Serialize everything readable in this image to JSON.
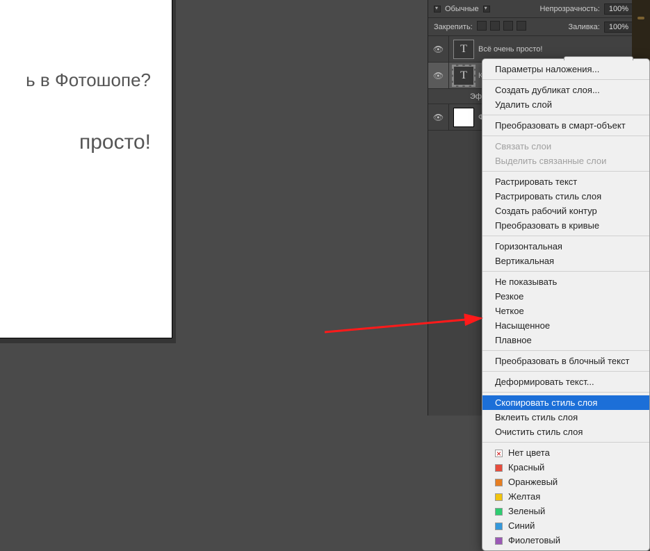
{
  "canvas_text": {
    "line1": "ь в Фотошопе?",
    "line2": "просто!"
  },
  "panel": {
    "blend_label": "Обычные",
    "opacity_label": "Непрозрачность:",
    "opacity_value": "100%",
    "lock_label": "Закрепить:",
    "fill_label": "Заливка:",
    "fill_value": "100%"
  },
  "layers": [
    {
      "name": "Всё очень просто!"
    },
    {
      "name": "Ка"
    },
    {
      "name": "Эфф"
    },
    {
      "name": "Фон"
    }
  ],
  "menu": {
    "blend_options": "Параметры наложения...",
    "duplicate": "Создать дубликат слоя...",
    "delete": "Удалить слой",
    "smart": "Преобразовать в смарт-объект",
    "link": "Связать слои",
    "select_linked": "Выделить связанные слои",
    "rasterize_text": "Растрировать текст",
    "rasterize_style": "Растрировать стиль слоя",
    "work_path": "Создать рабочий контур",
    "to_curves": "Преобразовать в кривые",
    "horizontal": "Горизонтальная",
    "vertical": "Вертикальная",
    "none": "Не показывать",
    "sharp": "Резкое",
    "crisp": "Четкое",
    "strong": "Насыщенное",
    "smooth": "Плавное",
    "to_paragraph": "Преобразовать в блочный текст",
    "warp": "Деформировать текст...",
    "copy_style": "Скопировать стиль слоя",
    "paste_style": "Вклеить стиль слоя",
    "clear_style": "Очистить стиль слоя",
    "colors": {
      "no_color": "Нет цвета",
      "red": "Красный",
      "orange": "Оранжевый",
      "yellow": "Желтая",
      "green": "Зеленый",
      "blue": "Синий",
      "violet": "Фиолетовый"
    }
  }
}
